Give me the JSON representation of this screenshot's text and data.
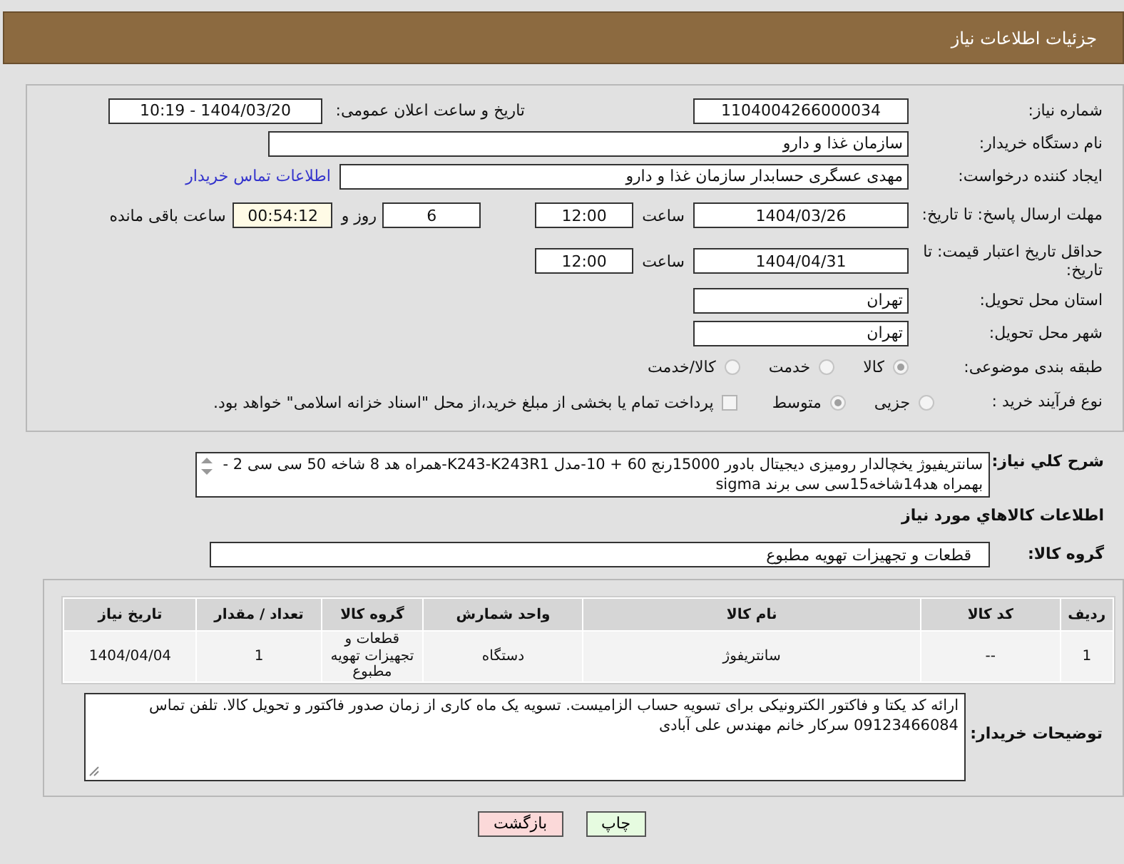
{
  "window": {
    "title": "جزئیات اطلاعات نیاز"
  },
  "form": {
    "need_number": {
      "label": "شماره نیاز:",
      "value": "1104004266000034"
    },
    "announce": {
      "label": "تاریخ و ساعت اعلان عمومی:",
      "value": "1404/03/20 - 10:19"
    },
    "buyer_org": {
      "label": "نام دستگاه خریدار:",
      "value": "سازمان غذا و دارو"
    },
    "requester": {
      "label": "ایجاد کننده درخواست:",
      "value": "مهدی عسگری حسابدار سازمان غذا و دارو",
      "link": "اطلاعات تماس خریدار"
    },
    "reply_deadline": {
      "label": "مهلت ارسال پاسخ: تا تاریخ:",
      "date": "1404/03/26",
      "time_label": "ساعت",
      "time": "12:00",
      "days": "6",
      "days_label": "روز و",
      "remaining": "00:54:12",
      "remaining_label": "ساعت باقی مانده"
    },
    "price_validity": {
      "label": "حداقل تاریخ اعتبار قیمت: تا تاریخ:",
      "date": "1404/04/31",
      "time_label": "ساعت",
      "time": "12:00"
    },
    "province": {
      "label": "استان محل تحویل:",
      "value": "تهران"
    },
    "city": {
      "label": "شهر محل تحویل:",
      "value": "تهران"
    },
    "category": {
      "label": "طبقه بندی موضوعی:",
      "options": [
        {
          "label": "کالا",
          "selected": true
        },
        {
          "label": "خدمت",
          "selected": false
        },
        {
          "label": "کالا/خدمت",
          "selected": false
        }
      ]
    },
    "process": {
      "label": "نوع فرآیند خرید :",
      "options": [
        {
          "label": "جزیی",
          "selected": false
        },
        {
          "label": "متوسط",
          "selected": true
        }
      ],
      "treasury": {
        "label": "پرداخت تمام یا بخشی از مبلغ خرید،از محل \"اسناد خزانه اسلامی\" خواهد بود.",
        "checked": false
      }
    }
  },
  "description": {
    "label": "شرح کلي نياز:",
    "value": "سانتریفیوژ یخچالدار رومیزی دیجیتال بادور 15000رنج 60 + 10-مدل K243-K243R1-همراه هد 8 شاخه 50 سی سی 2 - بهمراه هد14شاخه15سی سی برند sigma"
  },
  "goods_title": "اطلاعات کالاهاي مورد نياز",
  "goods_group": {
    "label": "گروه کالا:",
    "value": "قطعات و تجهیزات تهویه مطبوع"
  },
  "table": {
    "columns": [
      "ردیف",
      "کد کالا",
      "نام کالا",
      "واحد شمارش",
      "گروه کالا",
      "تعداد / مقدار",
      "تاریخ نیاز"
    ],
    "rows": [
      [
        "1",
        "--",
        "سانتریفوژ",
        "دستگاه",
        "قطعات و تجهیزات تهویه مطبوع",
        "1",
        "1404/04/04"
      ]
    ]
  },
  "buyer_notes": {
    "label": "توضیحات خریدار:",
    "value": "ارائه کد یکتا و فاکتور الکترونیکی برای تسویه حساب الزامیست. تسویه یک ماه کاری از زمان صدور فاکتور و تحویل کالا. تلفن تماس 09123466084 سرکار خانم مهندس علی آبادی"
  },
  "buttons": [
    {
      "label": "چاپ",
      "kind": "print"
    },
    {
      "label": "بازگشت",
      "kind": "back"
    }
  ]
}
